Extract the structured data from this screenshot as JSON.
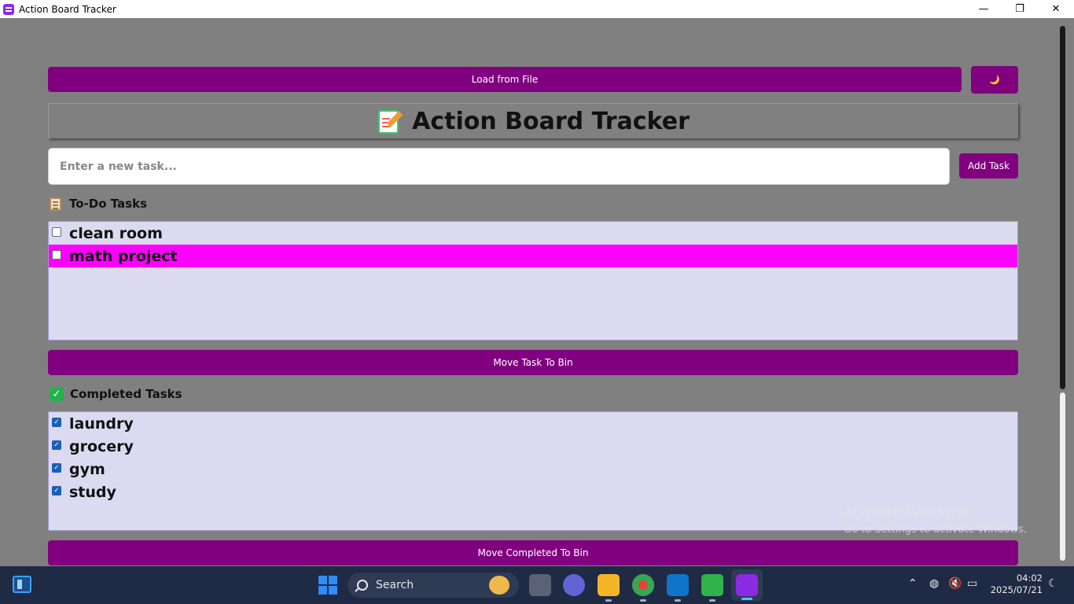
{
  "window": {
    "title": "Action Board Tracker",
    "controls": {
      "minimize": "—",
      "maximize": "❐",
      "close": "✕"
    }
  },
  "toolbar": {
    "load_label": "Load from File",
    "theme_label": "🌙"
  },
  "header": {
    "title": "Action Board Tracker",
    "icon": "memo-icon"
  },
  "input": {
    "placeholder": "Enter a new task...",
    "value": ""
  },
  "add_label": "Add Task",
  "todo": {
    "label": "To-Do Tasks",
    "items": [
      {
        "text": "clean room",
        "checked": false,
        "selected": false
      },
      {
        "text": "math project",
        "checked": false,
        "selected": true
      }
    ]
  },
  "move_label": "Move Task To Bin",
  "completed": {
    "label": "Completed Tasks",
    "items": [
      {
        "text": "laundry",
        "checked": true
      },
      {
        "text": "grocery",
        "checked": true
      },
      {
        "text": "gym",
        "checked": true
      },
      {
        "text": "study",
        "checked": true
      }
    ]
  },
  "move_completed_label": "Move Completed To Bin",
  "watermark": {
    "line1": "Activate Windows",
    "line2": "Go to Settings to activate Windows."
  },
  "taskbar": {
    "search_label": "Search",
    "time": "04:02",
    "date": "2025/07/21"
  },
  "colors": {
    "accent": "#800080",
    "selected_row": "#ff00ff",
    "list_bg": "#dcdaf0",
    "window_bg": "#808080"
  }
}
